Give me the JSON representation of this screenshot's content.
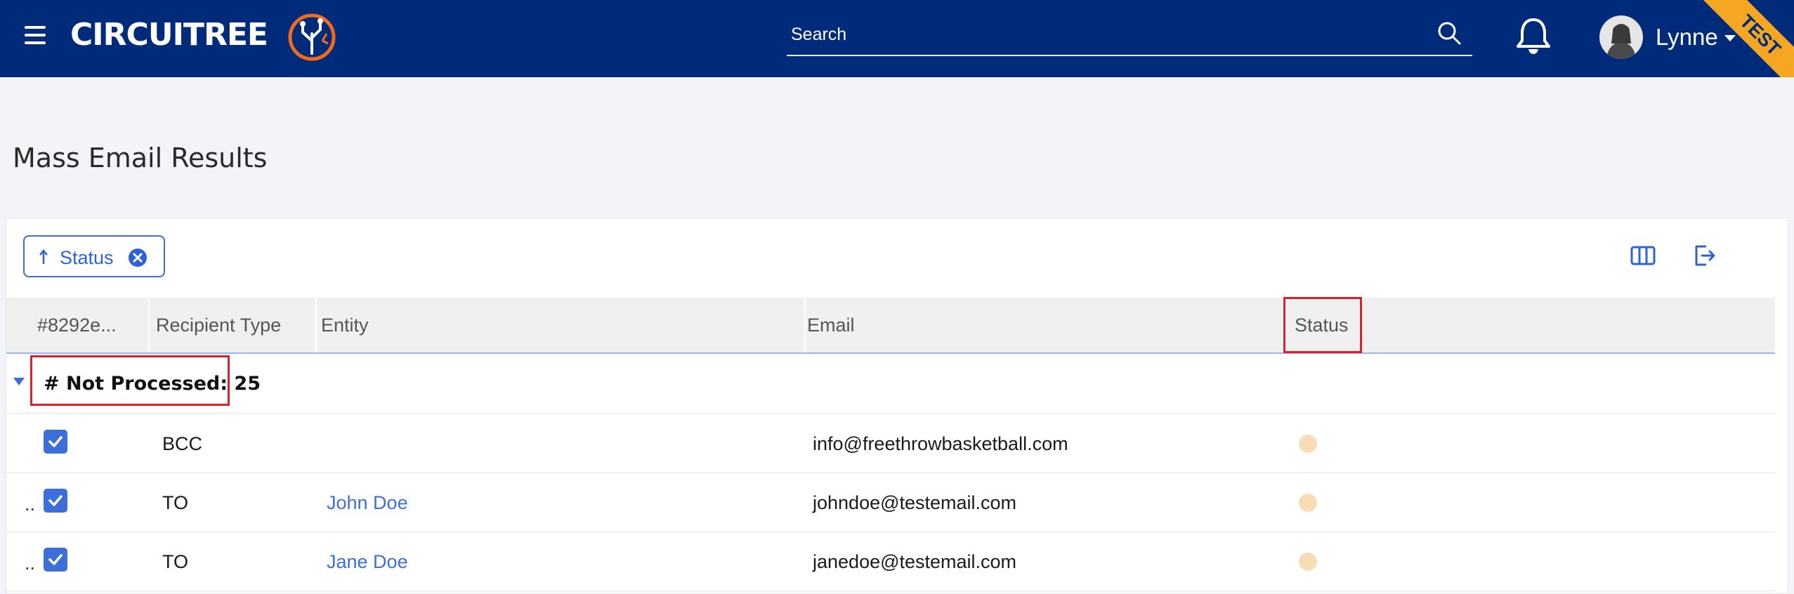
{
  "header": {
    "logo_text": "CIRCUITREE",
    "search_placeholder": "Search",
    "user_name": "Lynne",
    "environment_badge": "TEST"
  },
  "page": {
    "title": "Mass Email Results"
  },
  "toolbar": {
    "sort_chip_label": "Status"
  },
  "table": {
    "columns": [
      "#8292e...",
      "Recipient Type",
      "Entity",
      "Email",
      "Status"
    ],
    "group": {
      "label": "# Not Processed: 25"
    },
    "rows": [
      {
        "prefix": "",
        "checked": true,
        "recipient_type": "BCC",
        "entity": "",
        "email": "info@freethrowbasketball.com",
        "status_color": "#f7dcb4"
      },
      {
        "prefix": "..",
        "checked": true,
        "recipient_type": "TO",
        "entity": "John Doe",
        "email": "johndoe@testemail.com",
        "status_color": "#f7dcb4"
      },
      {
        "prefix": "..",
        "checked": true,
        "recipient_type": "TO",
        "entity": "Jane Doe",
        "email": "janedoe@testemail.com",
        "status_color": "#f7dcb4"
      }
    ]
  },
  "colors": {
    "header_bg": "#002b7a",
    "accent": "#3d6fd9",
    "highlight": "#e01f26",
    "badge": "#f5a623"
  }
}
